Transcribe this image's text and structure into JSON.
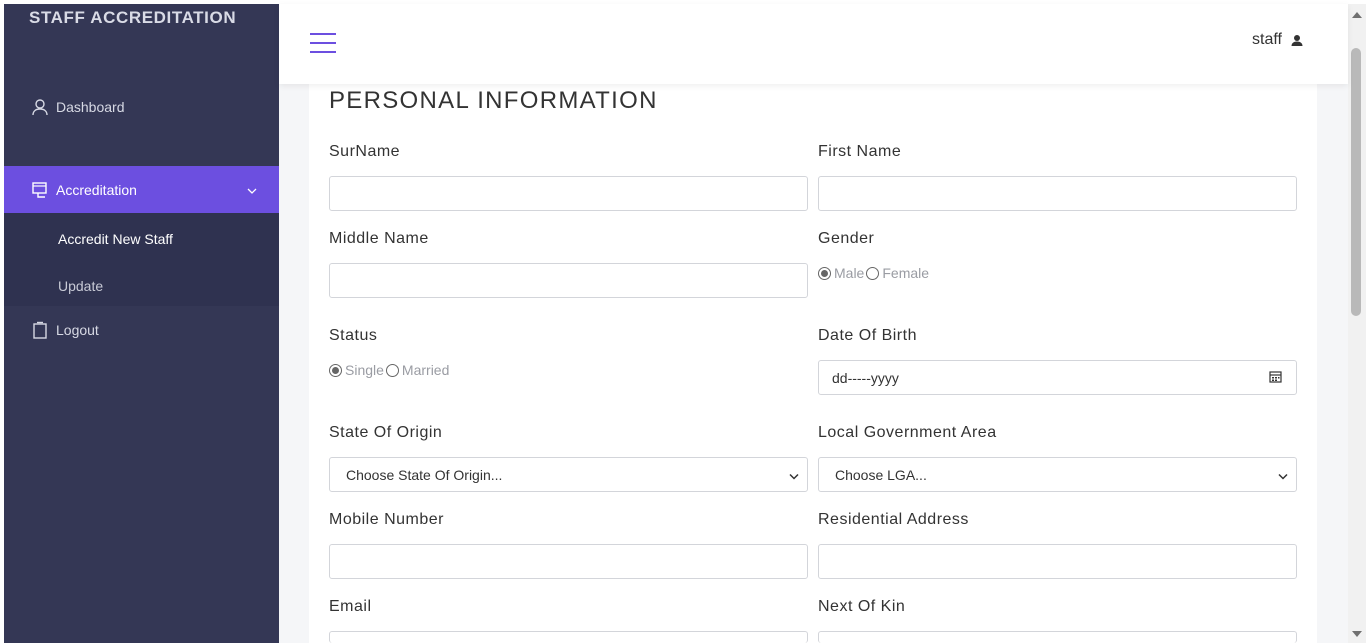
{
  "app": {
    "brand": "STAFF ACCREDITATION"
  },
  "sidebar": {
    "items": [
      {
        "label": "Dashboard",
        "icon": "user-outline-icon"
      },
      {
        "label": "Accreditation",
        "icon": "monitor-icon",
        "active": true
      },
      {
        "label": "Logout",
        "icon": "clipboard-icon"
      }
    ],
    "submenu": [
      {
        "label": "Accredit New Staff",
        "active": true
      },
      {
        "label": "Update"
      }
    ]
  },
  "topbar": {
    "username": "staff"
  },
  "form": {
    "section_title": "PERSONAL INFORMATION",
    "surname": {
      "label": "SurName",
      "value": ""
    },
    "first_name": {
      "label": "First Name",
      "value": ""
    },
    "middle_name": {
      "label": "Middle Name",
      "value": ""
    },
    "gender": {
      "label": "Gender",
      "options": [
        "Male",
        "Female"
      ],
      "selected": "Male"
    },
    "status": {
      "label": "Status",
      "options": [
        "Single",
        "Married"
      ],
      "selected": "Single"
    },
    "dob": {
      "label": "Date Of Birth",
      "placeholder": "dd-----yyyy"
    },
    "state_of_origin": {
      "label": "State Of Origin",
      "selected": "Choose State Of Origin..."
    },
    "lga": {
      "label": "Local Government Area",
      "selected": "Choose LGA..."
    },
    "mobile": {
      "label": "Mobile Number",
      "value": ""
    },
    "address": {
      "label": "Residential Address",
      "value": ""
    },
    "email": {
      "label": "Email",
      "value": ""
    },
    "next_of_kin": {
      "label": "Next Of Kin",
      "value": ""
    }
  },
  "colors": {
    "sidebar_bg": "#343755",
    "accent": "#6c4fe0",
    "submenu_bg": "#2f3250"
  }
}
